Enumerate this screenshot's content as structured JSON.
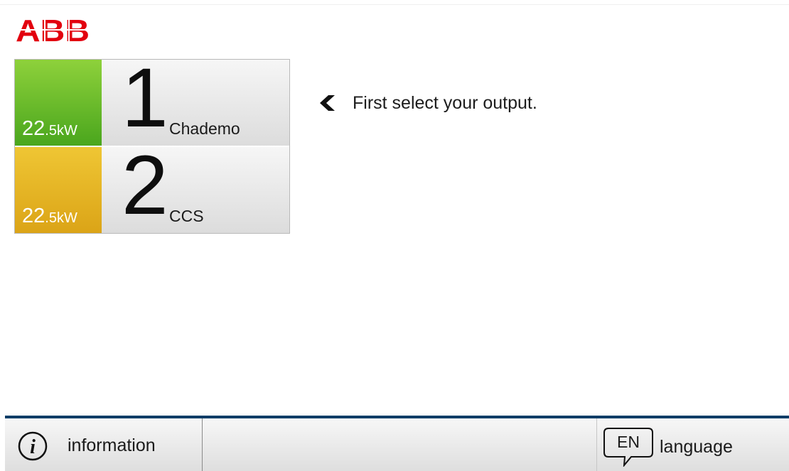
{
  "brand": {
    "logo_text": "ABB",
    "color": "#e2000f"
  },
  "outputs": [
    {
      "number": "1",
      "power_value": "22",
      "power_unit": ".5kW",
      "connector": "Chademo",
      "color": "#6cbf2b"
    },
    {
      "number": "2",
      "power_value": "22",
      "power_unit": ".5kW",
      "connector": "CCS",
      "color": "#e6b320"
    }
  ],
  "hint": {
    "text": "First select your output.",
    "icon": "chevron-left-icon"
  },
  "footer": {
    "information_label": "information",
    "information_icon": "info-icon",
    "language_code": "EN",
    "language_label": "language",
    "language_icon": "speech-bubble-icon",
    "accent_color": "#0b3d67"
  }
}
